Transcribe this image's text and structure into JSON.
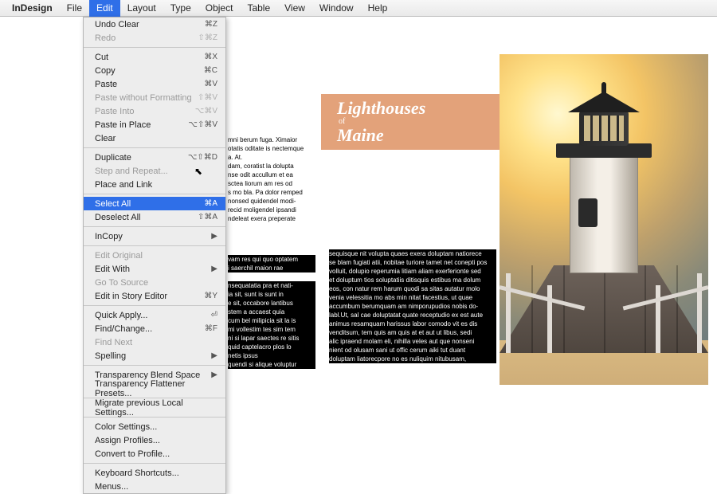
{
  "app_name": "InDesign",
  "menubar": [
    "File",
    "Edit",
    "Layout",
    "Type",
    "Object",
    "Table",
    "View",
    "Window",
    "Help"
  ],
  "open_menu_index": 1,
  "dropdown": {
    "groups": [
      [
        {
          "label": "Undo Clear",
          "shortcut": "⌘Z",
          "enabled": true
        },
        {
          "label": "Redo",
          "shortcut": "⇧⌘Z",
          "enabled": false
        }
      ],
      [
        {
          "label": "Cut",
          "shortcut": "⌘X",
          "enabled": true
        },
        {
          "label": "Copy",
          "shortcut": "⌘C",
          "enabled": true
        },
        {
          "label": "Paste",
          "shortcut": "⌘V",
          "enabled": true
        },
        {
          "label": "Paste without Formatting",
          "shortcut": "⇧⌘V",
          "enabled": false
        },
        {
          "label": "Paste Into",
          "shortcut": "⌥⌘V",
          "enabled": false
        },
        {
          "label": "Paste in Place",
          "shortcut": "⌥⇧⌘V",
          "enabled": true
        },
        {
          "label": "Clear",
          "shortcut": "",
          "enabled": true
        }
      ],
      [
        {
          "label": "Duplicate",
          "shortcut": "⌥⇧⌘D",
          "enabled": true
        },
        {
          "label": "Step and Repeat...",
          "shortcut": "",
          "enabled": false
        },
        {
          "label": "Place and Link",
          "shortcut": "",
          "enabled": true
        }
      ],
      [
        {
          "label": "Select All",
          "shortcut": "⌘A",
          "enabled": true,
          "highlight": true
        },
        {
          "label": "Deselect All",
          "shortcut": "⇧⌘A",
          "enabled": true
        }
      ],
      [
        {
          "label": "InCopy",
          "shortcut": "▶",
          "enabled": true,
          "submenu": true
        }
      ],
      [
        {
          "label": "Edit Original",
          "shortcut": "",
          "enabled": false
        },
        {
          "label": "Edit With",
          "shortcut": "▶",
          "enabled": true,
          "submenu": true
        },
        {
          "label": "Go To Source",
          "shortcut": "",
          "enabled": false
        },
        {
          "label": "Edit in Story Editor",
          "shortcut": "⌘Y",
          "enabled": true
        }
      ],
      [
        {
          "label": "Quick Apply...",
          "shortcut": "⏎",
          "enabled": true
        },
        {
          "label": "Find/Change...",
          "shortcut": "⌘F",
          "enabled": true
        },
        {
          "label": "Find Next",
          "shortcut": "",
          "enabled": false
        },
        {
          "label": "Spelling",
          "shortcut": "▶",
          "enabled": true,
          "submenu": true
        }
      ],
      [
        {
          "label": "Transparency Blend Space",
          "shortcut": "▶",
          "enabled": true,
          "submenu": true
        },
        {
          "label": "Transparency Flattener Presets...",
          "shortcut": "",
          "enabled": true
        }
      ],
      [
        {
          "label": "Migrate previous Local Settings...",
          "shortcut": "",
          "enabled": true
        }
      ],
      [
        {
          "label": "Color Settings...",
          "shortcut": "",
          "enabled": true
        },
        {
          "label": "Assign Profiles...",
          "shortcut": "",
          "enabled": true
        },
        {
          "label": "Convert to Profile...",
          "shortcut": "",
          "enabled": true
        }
      ],
      [
        {
          "label": "Keyboard Shortcuts...",
          "shortcut": "",
          "enabled": true
        },
        {
          "label": "Menus...",
          "shortcut": "",
          "enabled": true
        }
      ]
    ]
  },
  "banner": {
    "line1": "Lighthouses",
    "of": "of",
    "line2": "Maine"
  },
  "col1_lines": [
    {
      "t": "mni berum fuga. Ximaior",
      "s": false
    },
    {
      "t": "otatis oditate is nectemque",
      "s": false
    },
    {
      "t": "a. At.",
      "s": false
    },
    {
      "t": "dam, coratist la dolupta",
      "s": false
    },
    {
      "t": "nse odit accullum et ea",
      "s": false
    },
    {
      "t": "sctea liorum am res od",
      "s": false
    },
    {
      "t": "s mo bla. Pa dolor remped",
      "s": false
    },
    {
      "t": "nonsed quidendel modi-",
      "s": false
    },
    {
      "t": "recid moligendel ipsandi",
      "s": false
    },
    {
      "t": "ndeleat exera preperate",
      "s": false
    }
  ],
  "col2_lines": [
    {
      "t": "vam res qui quo optatem",
      "s": true
    },
    {
      "t": "i saerchil maion rae",
      "s": true
    },
    {
      "t": "",
      "s": false
    },
    {
      "t": "nsequatatia pra et nati-",
      "s": true
    },
    {
      "t": "ia sit, sunt is sunt in",
      "s": true
    },
    {
      "t": "e sit, occabore lantibus",
      "s": true
    },
    {
      "t": "stem a accaest quia",
      "s": true
    },
    {
      "t": "cum bel milipicia sit la is",
      "s": true
    },
    {
      "t": "mi vollestim tes sim tem",
      "s": true
    },
    {
      "t": "ni si lapar saectes re sitis",
      "s": true
    },
    {
      "t": "quid captelacro plos lo",
      "s": true
    },
    {
      "t": "netis ipsus",
      "s": true
    },
    {
      "t": "quendi si alique voluptur",
      "s": true
    }
  ],
  "col3_lines": [
    {
      "t": "sequisque nit volupta quaes exera doluptam natiorece",
      "s": true
    },
    {
      "t": "se blam fugiati atii, nobitae turiore tamet net conepti pos",
      "s": true
    },
    {
      "t": "volluit, dolupio reperumia litiam aliam exerferionte sed",
      "s": true
    },
    {
      "t": "et doluptum tios soluptatiis ditisquis estibus ma dolum",
      "s": true
    },
    {
      "t": "eos, con natur rem harum quodi sa sitas autatur molo",
      "s": true
    },
    {
      "t": "venia velessitia mo abs min nitat facestius, ut quae",
      "s": true
    },
    {
      "t": "accumbum berumquam am nimporupudios nobis do-",
      "s": true
    },
    {
      "t": "labl.Ut, sal cae doluptatat quate receptudio ex est aute",
      "s": true
    },
    {
      "t": "animus resamquam harissus labor comodo vit es dis",
      "s": true
    },
    {
      "t": "venditsum, tem quis am quis at et aut ut libus, sedi",
      "s": true
    },
    {
      "t": "alic ipraend molam eli, nihilla veles aut que nonseni",
      "s": true
    },
    {
      "t": "nient od olusam sani ut offic cerum aiki tut duant",
      "s": true
    },
    {
      "t": "doluptam liatorecpore no es nuliquim nitubusam,",
      "s": true
    }
  ]
}
